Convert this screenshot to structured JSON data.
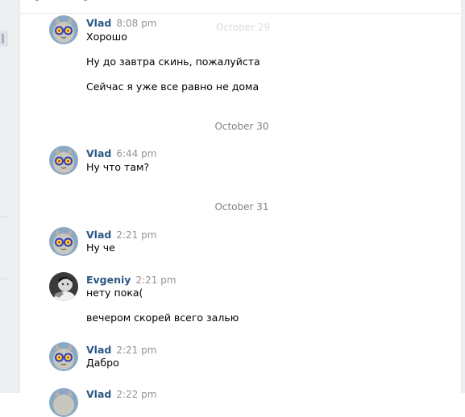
{
  "ghost_date": "October 29",
  "groups": [
    {
      "sender": "Vlad",
      "time": "8:08 pm",
      "messages": [
        "Хорошо",
        "Ну до завтра скинь, пожалуйста",
        "Сейчас я уже все равно не дома"
      ]
    },
    {
      "date": "October 30"
    },
    {
      "sender": "Vlad",
      "time": "6:44 pm",
      "messages": [
        "Ну что там?"
      ]
    },
    {
      "date": "October 31"
    },
    {
      "sender": "Vlad",
      "time": "2:21 pm",
      "messages": [
        "Ну че"
      ]
    },
    {
      "sender": "Evgeniy",
      "time": "2:21 pm",
      "messages": [
        "нету пока(",
        "вечером скорей всего залью"
      ]
    },
    {
      "sender": "Vlad",
      "time": "2:21 pm",
      "messages": [
        "Дабро"
      ]
    },
    {
      "sender": "Vlad",
      "time": "2:22 pm",
      "messages": []
    }
  ],
  "colors": {
    "sender_name": "#2a5885",
    "time": "#939393",
    "date_separator": "#828282"
  }
}
